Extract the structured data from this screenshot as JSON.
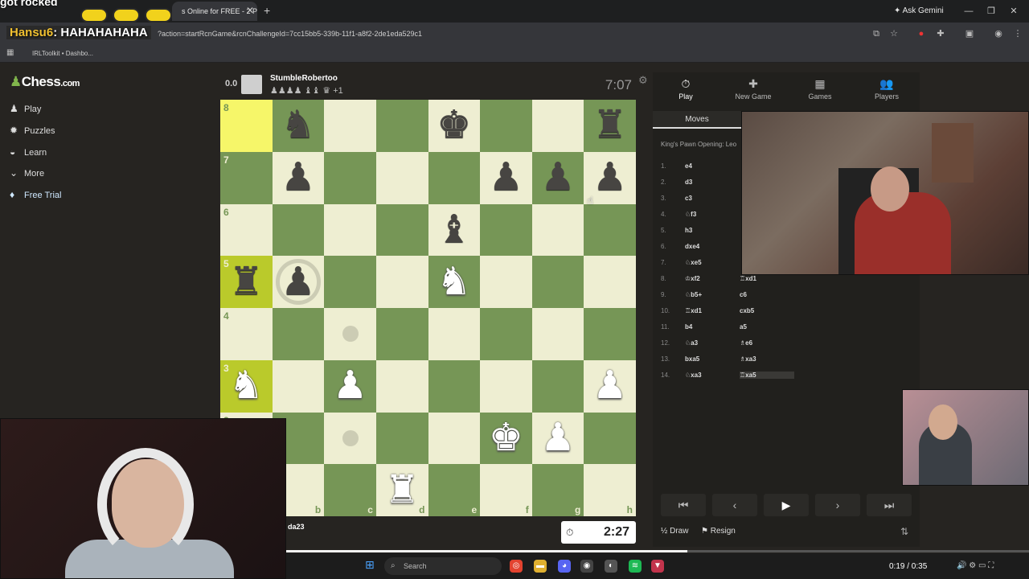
{
  "browser": {
    "overlay_top_text": "got rocked",
    "active_tab_title": "s Online for FREE - 2 P",
    "new_tab_glyph": "+",
    "ask_gemini_label": "✦ Ask Gemini",
    "url": "?action=startRcnGame&rcnChallengeId=7cc15bb5-339b-11f1-a8f2-2de1eda529c1",
    "bookmark": "IRLToolkit • Dashbo..."
  },
  "stream_overlay": {
    "chat_user": "Hansu6",
    "chat_message": "HAHAHAHAHA"
  },
  "sidebar": {
    "logo": "Chess",
    "logo_suffix": ".com",
    "items": [
      {
        "label": "Play",
        "icon": "pawn-icon"
      },
      {
        "label": "Puzzles",
        "icon": "puzzle-icon"
      },
      {
        "label": "Learn",
        "icon": "learn-icon"
      },
      {
        "label": "More",
        "icon": "chevron-down-icon"
      },
      {
        "label": "Free Trial",
        "icon": "diamond-icon"
      }
    ]
  },
  "top_player": {
    "score": "0.0",
    "name": "StumbleRobertoo",
    "captured": "♟♟♟♟ ♝♝ ♛ +1",
    "clock": "7:07"
  },
  "bottom_player": {
    "name": "da23",
    "clock": "2:27"
  },
  "board": {
    "ranks": [
      "8",
      "7",
      "6",
      "5",
      "4",
      "3",
      "2",
      "1"
    ],
    "files": [
      "a",
      "b",
      "c",
      "d",
      "e",
      "f",
      "g",
      "h"
    ],
    "rows": [
      [
        "",
        "bN",
        "",
        "",
        "bK",
        "",
        "",
        "bR"
      ],
      [
        "",
        "bP",
        "",
        "",
        "",
        "bP",
        "bP",
        "bP"
      ],
      [
        "",
        "",
        "",
        "",
        "bB",
        "",
        "",
        ""
      ],
      [
        "bR",
        "bP",
        "",
        "",
        "wN",
        "",
        "",
        ""
      ],
      [
        "",
        "",
        "",
        "",
        "",
        "",
        "",
        ""
      ],
      [
        "wN",
        "",
        "wP",
        "",
        "",
        "",
        "",
        "wP"
      ],
      [
        "",
        "",
        "",
        "",
        "",
        "wK",
        "wP",
        ""
      ],
      [
        "",
        "",
        "",
        "wR",
        "",
        "",
        "",
        ""
      ]
    ],
    "highlights": [
      "a8",
      "a5",
      "a3"
    ],
    "dots": [
      "c4",
      "c2",
      "a1"
    ],
    "rings": [
      "b5"
    ]
  },
  "panel": {
    "tabs": [
      {
        "label": "Play",
        "icon": "stopwatch-icon"
      },
      {
        "label": "New Game",
        "icon": "plus-icon"
      },
      {
        "label": "Games",
        "icon": "board-icon"
      },
      {
        "label": "Players",
        "icon": "players-icon"
      }
    ],
    "moves_tab": "Moves",
    "opening": "King's Pawn Opening: Leo",
    "moves": [
      {
        "n": "1.",
        "w": "e4",
        "b": ""
      },
      {
        "n": "2.",
        "w": "d3",
        "b": ""
      },
      {
        "n": "3.",
        "w": "c3",
        "b": ""
      },
      {
        "n": "4.",
        "w": "♘f3",
        "b": ""
      },
      {
        "n": "5.",
        "w": "h3",
        "b": ""
      },
      {
        "n": "6.",
        "w": "dxe4",
        "b": ""
      },
      {
        "n": "7.",
        "w": "♘xe5",
        "b": ""
      },
      {
        "n": "8.",
        "w": "♔xf2",
        "b": "♖xd1"
      },
      {
        "n": "9.",
        "w": "♘b5+",
        "b": "c6"
      },
      {
        "n": "10.",
        "w": "♖xd1",
        "b": "cxb5"
      },
      {
        "n": "11.",
        "w": "b4",
        "b": "a5"
      },
      {
        "n": "12.",
        "w": "♘a3",
        "b": "♗e6"
      },
      {
        "n": "13.",
        "w": "bxa5",
        "b": "♗xa3"
      },
      {
        "n": "14.",
        "w": "♘xa3",
        "b": "♖xa5"
      }
    ],
    "nav": [
      "⏮",
      "‹",
      "▶",
      "›",
      "⏭"
    ],
    "draw_label": "½ Draw",
    "resign_label": "⚑ Resign"
  },
  "taskbar": {
    "search_placeholder": "Search",
    "timecode": "0:19 / 0:35",
    "progress": 0.54
  }
}
